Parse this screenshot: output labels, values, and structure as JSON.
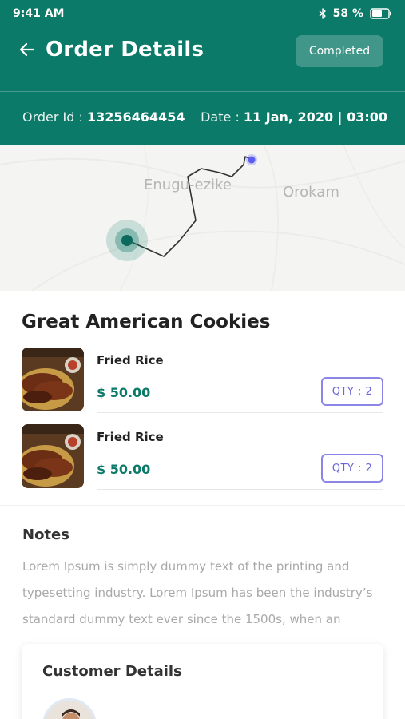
{
  "status_bar": {
    "time": "9:41 AM",
    "battery": "58 %",
    "icons": [
      "bluetooth-icon",
      "battery-icon"
    ]
  },
  "header": {
    "back_icon": "left-arrow-icon",
    "title": "Order Details",
    "status": "Completed",
    "order_id_label": "Order Id :",
    "order_id": "13256464454",
    "date_label": "Date :",
    "date": "11 Jan, 2020 | 03:00"
  },
  "map": {
    "labels": [
      "Enugu-ezike",
      "Orokam"
    ]
  },
  "store": {
    "name": "Great American Cookies",
    "items": [
      {
        "name": "Fried Rice",
        "price": "$ 50.00",
        "qty": "QTY : 2"
      },
      {
        "name": "Fried Rice",
        "price": "$ 50.00",
        "qty": "QTY : 2"
      }
    ]
  },
  "notes": {
    "title": "Notes",
    "text": "Lorem Ipsum is simply dummy text of the printing and typesetting industry. Lorem Ipsum has been the industry’s standard dummy text ever since the 1500s, when an"
  },
  "customer": {
    "title": "Customer Details"
  },
  "colors": {
    "primary": "#0b7a68",
    "qty_border": "#8b86e6",
    "notes_text": "#a9a9a9"
  }
}
